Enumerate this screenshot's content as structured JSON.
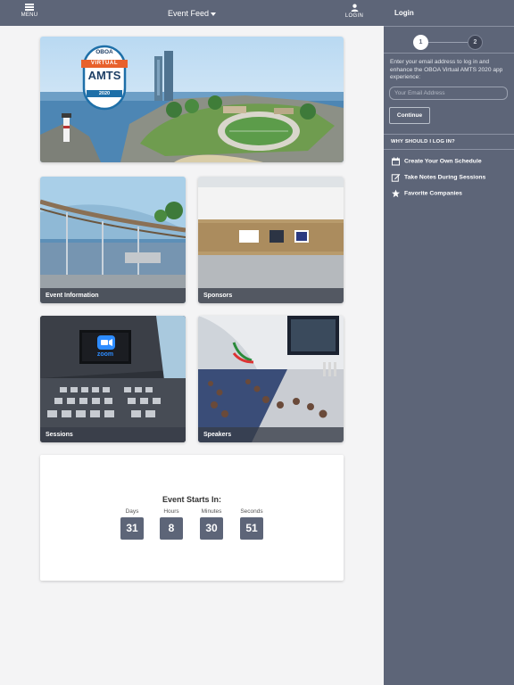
{
  "header": {
    "menu_label": "MENU",
    "title": "Event Feed",
    "login_label": "LOGIN"
  },
  "hero": {
    "badge": {
      "org": "OBOA",
      "line1": "VIRTUAL",
      "line2": "AMTS",
      "year": "2020"
    }
  },
  "tiles": [
    {
      "label": "Event Information"
    },
    {
      "label": "Sponsors"
    },
    {
      "label": "Sessions",
      "screen_text": "zoom"
    },
    {
      "label": "Speakers"
    }
  ],
  "countdown": {
    "title": "Event Starts In:",
    "units": [
      {
        "label": "Days",
        "value": "31"
      },
      {
        "label": "Hours",
        "value": "8"
      },
      {
        "label": "Minutes",
        "value": "30"
      },
      {
        "label": "Seconds",
        "value": "51"
      }
    ]
  },
  "login_panel": {
    "title": "Login",
    "steps": [
      "1",
      "2"
    ],
    "description": "Enter your email address to log in and enhance the OBOA Virtual AMTS 2020 app experience:",
    "email_placeholder": "Your Email Address",
    "continue_label": "Continue",
    "why_heading": "WHY SHOULD I LOG IN?",
    "benefits": [
      {
        "icon": "calendar-icon",
        "label": "Create Your Own Schedule"
      },
      {
        "icon": "edit-note-icon",
        "label": "Take Notes During Sessions"
      },
      {
        "icon": "star-icon",
        "label": "Favorite Companies"
      }
    ]
  },
  "colors": {
    "panel": "#5d6578",
    "accent_orange": "#e8612c",
    "badge_blue": "#1e6fa8"
  }
}
